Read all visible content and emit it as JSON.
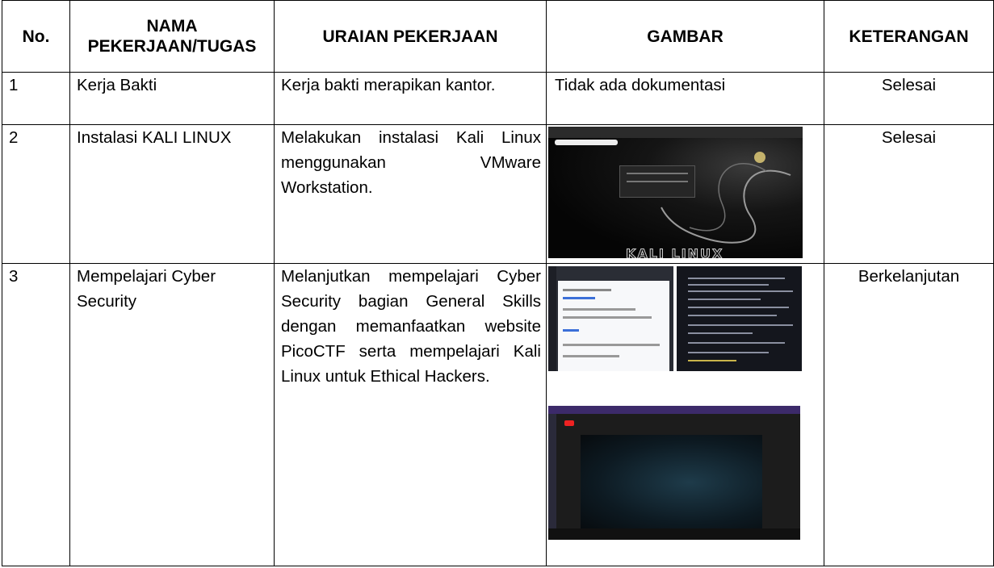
{
  "headers": {
    "no": "No.",
    "nama": "NAMA PEKERJAAN/TUGAS",
    "uraian": "URAIAN PEKERJAAN",
    "gambar": "GAMBAR",
    "keterangan": "KETERANGAN"
  },
  "rows": [
    {
      "no": "1",
      "nama": "Kerja Bakti",
      "uraian": "Kerja bakti merapikan kantor.",
      "gambar": "Tidak ada dokumentasi",
      "keterangan": "Selesai"
    },
    {
      "no": "2",
      "nama": "Instalasi KALI LINUX",
      "uraian": "Melakukan instalasi Kali Linux menggunakan VMware Workstation.",
      "gambar_logo": "KALI LINUX",
      "keterangan": "Selesai"
    },
    {
      "no": "3",
      "nama": "Mempelajari Cyber Security",
      "uraian": "Melanjutkan mempelajari Cyber Security bagian General Skills dengan memanfaatkan website PicoCTF serta mempelajari Kali Linux untuk Ethical Hackers.",
      "keterangan": "Berkelanjutan"
    }
  ]
}
